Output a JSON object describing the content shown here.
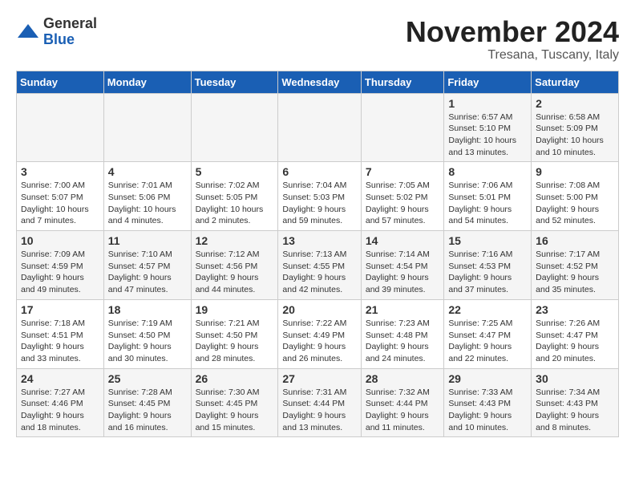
{
  "logo": {
    "general": "General",
    "blue": "Blue"
  },
  "header": {
    "month": "November 2024",
    "location": "Tresana, Tuscany, Italy"
  },
  "weekdays": [
    "Sunday",
    "Monday",
    "Tuesday",
    "Wednesday",
    "Thursday",
    "Friday",
    "Saturday"
  ],
  "weeks": [
    [
      {
        "day": "",
        "info": ""
      },
      {
        "day": "",
        "info": ""
      },
      {
        "day": "",
        "info": ""
      },
      {
        "day": "",
        "info": ""
      },
      {
        "day": "",
        "info": ""
      },
      {
        "day": "1",
        "info": "Sunrise: 6:57 AM\nSunset: 5:10 PM\nDaylight: 10 hours\nand 13 minutes."
      },
      {
        "day": "2",
        "info": "Sunrise: 6:58 AM\nSunset: 5:09 PM\nDaylight: 10 hours\nand 10 minutes."
      }
    ],
    [
      {
        "day": "3",
        "info": "Sunrise: 7:00 AM\nSunset: 5:07 PM\nDaylight: 10 hours\nand 7 minutes."
      },
      {
        "day": "4",
        "info": "Sunrise: 7:01 AM\nSunset: 5:06 PM\nDaylight: 10 hours\nand 4 minutes."
      },
      {
        "day": "5",
        "info": "Sunrise: 7:02 AM\nSunset: 5:05 PM\nDaylight: 10 hours\nand 2 minutes."
      },
      {
        "day": "6",
        "info": "Sunrise: 7:04 AM\nSunset: 5:03 PM\nDaylight: 9 hours\nand 59 minutes."
      },
      {
        "day": "7",
        "info": "Sunrise: 7:05 AM\nSunset: 5:02 PM\nDaylight: 9 hours\nand 57 minutes."
      },
      {
        "day": "8",
        "info": "Sunrise: 7:06 AM\nSunset: 5:01 PM\nDaylight: 9 hours\nand 54 minutes."
      },
      {
        "day": "9",
        "info": "Sunrise: 7:08 AM\nSunset: 5:00 PM\nDaylight: 9 hours\nand 52 minutes."
      }
    ],
    [
      {
        "day": "10",
        "info": "Sunrise: 7:09 AM\nSunset: 4:59 PM\nDaylight: 9 hours\nand 49 minutes."
      },
      {
        "day": "11",
        "info": "Sunrise: 7:10 AM\nSunset: 4:57 PM\nDaylight: 9 hours\nand 47 minutes."
      },
      {
        "day": "12",
        "info": "Sunrise: 7:12 AM\nSunset: 4:56 PM\nDaylight: 9 hours\nand 44 minutes."
      },
      {
        "day": "13",
        "info": "Sunrise: 7:13 AM\nSunset: 4:55 PM\nDaylight: 9 hours\nand 42 minutes."
      },
      {
        "day": "14",
        "info": "Sunrise: 7:14 AM\nSunset: 4:54 PM\nDaylight: 9 hours\nand 39 minutes."
      },
      {
        "day": "15",
        "info": "Sunrise: 7:16 AM\nSunset: 4:53 PM\nDaylight: 9 hours\nand 37 minutes."
      },
      {
        "day": "16",
        "info": "Sunrise: 7:17 AM\nSunset: 4:52 PM\nDaylight: 9 hours\nand 35 minutes."
      }
    ],
    [
      {
        "day": "17",
        "info": "Sunrise: 7:18 AM\nSunset: 4:51 PM\nDaylight: 9 hours\nand 33 minutes."
      },
      {
        "day": "18",
        "info": "Sunrise: 7:19 AM\nSunset: 4:50 PM\nDaylight: 9 hours\nand 30 minutes."
      },
      {
        "day": "19",
        "info": "Sunrise: 7:21 AM\nSunset: 4:50 PM\nDaylight: 9 hours\nand 28 minutes."
      },
      {
        "day": "20",
        "info": "Sunrise: 7:22 AM\nSunset: 4:49 PM\nDaylight: 9 hours\nand 26 minutes."
      },
      {
        "day": "21",
        "info": "Sunrise: 7:23 AM\nSunset: 4:48 PM\nDaylight: 9 hours\nand 24 minutes."
      },
      {
        "day": "22",
        "info": "Sunrise: 7:25 AM\nSunset: 4:47 PM\nDaylight: 9 hours\nand 22 minutes."
      },
      {
        "day": "23",
        "info": "Sunrise: 7:26 AM\nSunset: 4:47 PM\nDaylight: 9 hours\nand 20 minutes."
      }
    ],
    [
      {
        "day": "24",
        "info": "Sunrise: 7:27 AM\nSunset: 4:46 PM\nDaylight: 9 hours\nand 18 minutes."
      },
      {
        "day": "25",
        "info": "Sunrise: 7:28 AM\nSunset: 4:45 PM\nDaylight: 9 hours\nand 16 minutes."
      },
      {
        "day": "26",
        "info": "Sunrise: 7:30 AM\nSunset: 4:45 PM\nDaylight: 9 hours\nand 15 minutes."
      },
      {
        "day": "27",
        "info": "Sunrise: 7:31 AM\nSunset: 4:44 PM\nDaylight: 9 hours\nand 13 minutes."
      },
      {
        "day": "28",
        "info": "Sunrise: 7:32 AM\nSunset: 4:44 PM\nDaylight: 9 hours\nand 11 minutes."
      },
      {
        "day": "29",
        "info": "Sunrise: 7:33 AM\nSunset: 4:43 PM\nDaylight: 9 hours\nand 10 minutes."
      },
      {
        "day": "30",
        "info": "Sunrise: 7:34 AM\nSunset: 4:43 PM\nDaylight: 9 hours\nand 8 minutes."
      }
    ]
  ]
}
